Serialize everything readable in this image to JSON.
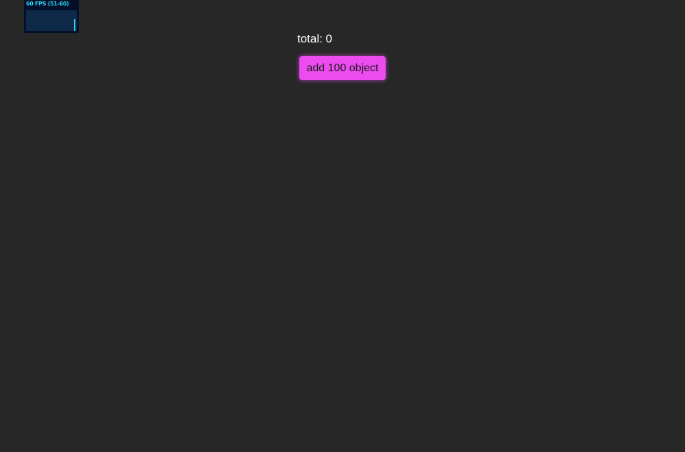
{
  "stats": {
    "fps_label": "60 FPS (51-60)",
    "bar_level": 0.55,
    "accent_color": "#2fd3f5"
  },
  "counter": {
    "total_text": "total: 0"
  },
  "controls": {
    "add_button_label": "add 100 object",
    "button_color": "#ec4cef"
  },
  "background_color": "#272727"
}
